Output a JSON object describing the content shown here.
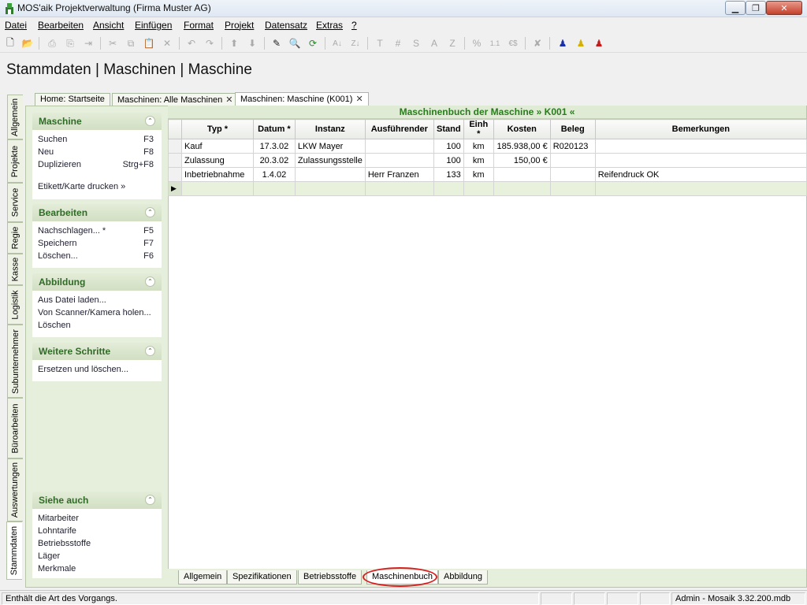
{
  "window": {
    "title": "MOS'aik Projektverwaltung (Firma Muster AG)",
    "min_glyph": "▁",
    "max_glyph": "❐",
    "close_glyph": "✕"
  },
  "menu": [
    "Datei",
    "Bearbeiten",
    "Ansicht",
    "Einfügen",
    "Format",
    "Projekt",
    "Datensatz",
    "Extras",
    "?"
  ],
  "toolbar_icons": [
    "new-icon",
    "open-icon",
    "print-icon",
    "print-preview-icon",
    "export-icon",
    "cut-icon",
    "copy-icon",
    "paste-icon",
    "delete-icon",
    "undo-icon",
    "redo-icon",
    "move-up-icon",
    "move-down-icon",
    "edit-icon",
    "find-icon",
    "refresh-icon",
    "sort-asc-icon",
    "sort-desc-icon",
    "text-T-icon",
    "number-hash-icon",
    "sum-S-icon",
    "text-A-icon",
    "text-Z-icon",
    "percent-icon",
    "calc-icon",
    "currency-icon",
    "flag-icon",
    "user-blue-icon",
    "user-yellow-icon",
    "user-red-icon"
  ],
  "toolbar_glyphs": {
    "new": "🗋",
    "open": "📂",
    "print": "⎙",
    "print_preview": "⎘",
    "export": "⇥",
    "cut": "✂",
    "copy": "⧉",
    "paste": "📋",
    "delete": "✕",
    "undo": "↶",
    "redo": "↷",
    "up": "⬆",
    "down": "⬇",
    "edit": "✎",
    "find": "🔍",
    "refresh": "⟳",
    "sort_asc": "A↓",
    "sort_desc": "Z↓",
    "t": "T",
    "hash": "#",
    "s": "S",
    "a": "A",
    "z": "Z",
    "percent": "%",
    "calc": "1.1",
    "currency": "€$",
    "flag": "✘",
    "user": "♟"
  },
  "page_title": "Stammdaten | Maschinen | Maschine",
  "doc_tabs": [
    {
      "label": "Home: Startseite",
      "closable": false,
      "active": false
    },
    {
      "label": "Maschinen: Alle Maschinen",
      "closable": true,
      "active": false
    },
    {
      "label": "Maschinen: Maschine (K001)",
      "closable": true,
      "active": true
    }
  ],
  "tab_close_glyph": "✕",
  "left_tabs": [
    "Allgemein",
    "Projekte",
    "Service",
    "Regie",
    "Kasse",
    "Logistik",
    "Subunternehmer",
    "Büroarbeiten",
    "Auswertungen",
    "Stammdaten"
  ],
  "left_tabs_active": "Stammdaten",
  "collapse_glyph": "⌃",
  "task_panels": {
    "maschine": {
      "title": "Maschine",
      "items": [
        {
          "label": "Suchen",
          "key": "F3"
        },
        {
          "label": "Neu",
          "key": "F8"
        },
        {
          "label": "Duplizieren",
          "key": "Strg+F8"
        },
        {
          "label": "Etikett/Karte drucken »",
          "key": ""
        }
      ]
    },
    "bearbeiten": {
      "title": "Bearbeiten",
      "items": [
        {
          "label": "Nachschlagen... *",
          "key": "F5"
        },
        {
          "label": "Speichern",
          "key": "F7"
        },
        {
          "label": "Löschen...",
          "key": "F6"
        }
      ]
    },
    "abbildung": {
      "title": "Abbildung",
      "items": [
        {
          "label": "Aus Datei laden...",
          "key": ""
        },
        {
          "label": "Von Scanner/Kamera holen...",
          "key": ""
        },
        {
          "label": "Löschen",
          "key": ""
        }
      ]
    },
    "weitere": {
      "title": "Weitere Schritte",
      "items": [
        {
          "label": "Ersetzen und löschen...",
          "key": ""
        }
      ]
    },
    "siehe_auch": {
      "title": "Siehe auch",
      "items": [
        {
          "label": "Mitarbeiter"
        },
        {
          "label": "Lohntarife"
        },
        {
          "label": "Betriebsstoffe"
        },
        {
          "label": "Läger"
        },
        {
          "label": "Merkmale"
        }
      ]
    }
  },
  "grid": {
    "title": "Maschinenbuch der Maschine » K001 «",
    "columns": [
      "Typ *",
      "Datum *",
      "Instanz",
      "Ausführender",
      "Stand",
      "Einh *",
      "Kosten",
      "Beleg",
      "Bemerkungen"
    ],
    "rows": [
      [
        "Kauf",
        "17.3.02",
        "LKW Mayer",
        "",
        "100",
        "km",
        "185.938,00 €",
        "R020123",
        ""
      ],
      [
        "Zulassung",
        "20.3.02",
        "Zulassungsstelle",
        "",
        "100",
        "km",
        "150,00 €",
        "",
        ""
      ],
      [
        "Inbetriebnahme",
        "1.4.02",
        "",
        "Herr Franzen",
        "133",
        "km",
        "",
        "",
        "Reifendruck OK"
      ]
    ],
    "new_row_marker": "▶"
  },
  "bottom_tabs": [
    {
      "label": "Allgemein",
      "active": false
    },
    {
      "label": "Spezifikationen",
      "active": false
    },
    {
      "label": "Betriebsstoffe",
      "active": false
    },
    {
      "label": "Maschinenbuch",
      "active": true
    },
    {
      "label": "Abbildung",
      "active": false
    }
  ],
  "status": {
    "hint": "Enthält die Art des Vorgangs.",
    "db": "Admin - Mosaik 3.32.200.mdb"
  },
  "colors": {
    "accent_green": "#2f6a26",
    "highlight_red": "#d62020",
    "panel_bg": "#e6efdb"
  }
}
